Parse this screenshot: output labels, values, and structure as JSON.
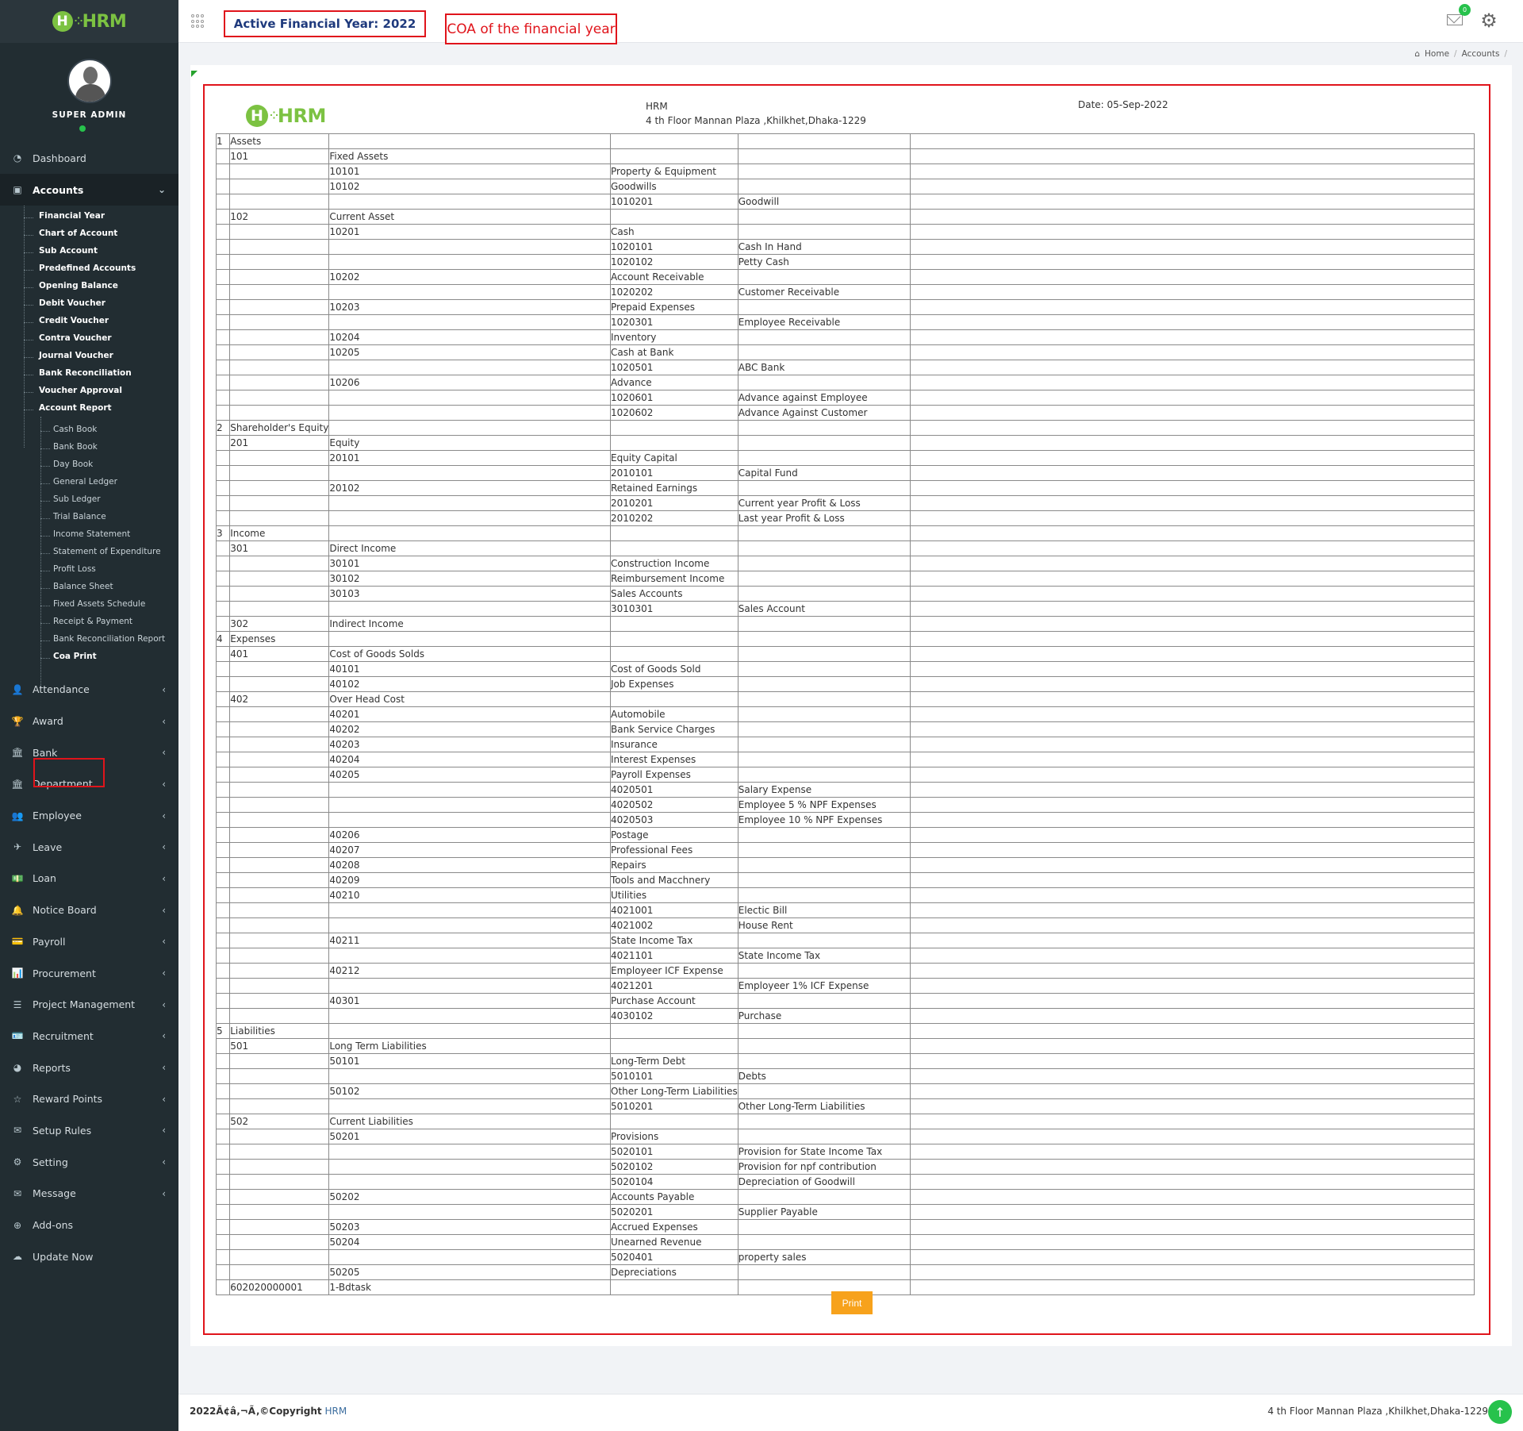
{
  "brand": {
    "logo_letter": "H",
    "logo_text": "HRM"
  },
  "user": {
    "name": "SUPER ADMIN"
  },
  "header": {
    "active_financial_year": "Active Financial Year: 2022",
    "page_title": "COA of the financial year",
    "mail_badge": "0"
  },
  "breadcrumb": {
    "home": "Home",
    "current": "Accounts"
  },
  "sidebar": {
    "dashboard": "Dashboard",
    "accounts": "Accounts",
    "accounts_sub": [
      "Financial Year",
      "Chart of Account",
      "Sub Account",
      "Predefined Accounts",
      "Opening Balance",
      "Debit Voucher",
      "Credit Voucher",
      "Contra Voucher",
      "Journal Voucher",
      "Bank Reconciliation",
      "Voucher Approval",
      "Account Report"
    ],
    "report_sub": [
      "Cash Book",
      "Bank Book",
      "Day Book",
      "General Ledger",
      "Sub Ledger",
      "Trial Balance",
      "Income Statement",
      "Statement of Expenditure",
      "Profit Loss",
      "Balance Sheet",
      "Fixed Assets Schedule",
      "Receipt & Payment",
      "Bank Reconciliation Report",
      "Coa Print"
    ],
    "modules": [
      {
        "label": "Attendance",
        "icon": "user-icon",
        "glyph": "👤"
      },
      {
        "label": "Award",
        "icon": "trophy-icon",
        "glyph": "🏆"
      },
      {
        "label": "Bank",
        "icon": "bank-icon",
        "glyph": "🏛"
      },
      {
        "label": "Department",
        "icon": "building-icon",
        "glyph": "🏛"
      },
      {
        "label": "Employee",
        "icon": "users-icon",
        "glyph": "👥"
      },
      {
        "label": "Leave",
        "icon": "plane-icon",
        "glyph": "✈"
      },
      {
        "label": "Loan",
        "icon": "money-icon",
        "glyph": "💵"
      },
      {
        "label": "Notice Board",
        "icon": "bell-icon",
        "glyph": "🔔"
      },
      {
        "label": "Payroll",
        "icon": "card-icon",
        "glyph": "💳"
      },
      {
        "label": "Procurement",
        "icon": "chart-icon",
        "glyph": "📊"
      },
      {
        "label": "Project Management",
        "icon": "server-icon",
        "glyph": "☰"
      },
      {
        "label": "Recruitment",
        "icon": "id-card-icon",
        "glyph": "🪪"
      },
      {
        "label": "Reports",
        "icon": "pie-chart-icon",
        "glyph": "◕"
      },
      {
        "label": "Reward Points",
        "icon": "star-icon",
        "glyph": "☆"
      },
      {
        "label": "Setup Rules",
        "icon": "envelope-icon",
        "glyph": "✉"
      },
      {
        "label": "Setting",
        "icon": "gear-icon",
        "glyph": "⚙"
      },
      {
        "label": "Message",
        "icon": "envelope-icon",
        "glyph": "✉"
      },
      {
        "label": "Add-ons",
        "icon": "plus-circle-icon",
        "glyph": "⊕"
      },
      {
        "label": "Update Now",
        "icon": "cloud-icon",
        "glyph": "☁"
      }
    ]
  },
  "document": {
    "company_name": "HRM",
    "company_address": "4 th Floor Mannan Plaza ,Khilkhet,Dhaka-1229",
    "date": "Date: 05-Sep-2022",
    "print_label": "Print"
  },
  "coa_rows": [
    [
      "1",
      "Assets",
      "",
      "",
      "",
      ""
    ],
    [
      "",
      "101",
      "Fixed Assets",
      "",
      "",
      ""
    ],
    [
      "",
      "",
      "10101",
      "Property & Equipment",
      "",
      ""
    ],
    [
      "",
      "",
      "10102",
      "Goodwills",
      "",
      ""
    ],
    [
      "",
      "",
      "",
      "1010201",
      "Goodwill",
      ""
    ],
    [
      "",
      "102",
      "Current Asset",
      "",
      "",
      ""
    ],
    [
      "",
      "",
      "10201",
      "Cash",
      "",
      ""
    ],
    [
      "",
      "",
      "",
      "1020101",
      "Cash In Hand",
      ""
    ],
    [
      "",
      "",
      "",
      "1020102",
      "Petty Cash",
      ""
    ],
    [
      "",
      "",
      "10202",
      "Account Receivable",
      "",
      ""
    ],
    [
      "",
      "",
      "",
      "1020202",
      "Customer Receivable",
      ""
    ],
    [
      "",
      "",
      "10203",
      "Prepaid Expenses",
      "",
      ""
    ],
    [
      "",
      "",
      "",
      "1020301",
      "Employee Receivable",
      ""
    ],
    [
      "",
      "",
      "10204",
      "Inventory",
      "",
      ""
    ],
    [
      "",
      "",
      "10205",
      "Cash at Bank",
      "",
      ""
    ],
    [
      "",
      "",
      "",
      "1020501",
      "ABC Bank",
      ""
    ],
    [
      "",
      "",
      "10206",
      "Advance",
      "",
      ""
    ],
    [
      "",
      "",
      "",
      "1020601",
      "Advance against Employee",
      ""
    ],
    [
      "",
      "",
      "",
      "1020602",
      "Advance Against Customer",
      ""
    ],
    [
      "2",
      "Shareholder's Equity",
      "",
      "",
      "",
      ""
    ],
    [
      "",
      "201",
      "Equity",
      "",
      "",
      ""
    ],
    [
      "",
      "",
      "20101",
      "Equity Capital",
      "",
      ""
    ],
    [
      "",
      "",
      "",
      "2010101",
      "Capital Fund",
      ""
    ],
    [
      "",
      "",
      "20102",
      "Retained Earnings",
      "",
      ""
    ],
    [
      "",
      "",
      "",
      "2010201",
      "Current year Profit & Loss",
      ""
    ],
    [
      "",
      "",
      "",
      "2010202",
      "Last year Profit & Loss",
      ""
    ],
    [
      "3",
      "Income",
      "",
      "",
      "",
      ""
    ],
    [
      "",
      "301",
      "Direct Income",
      "",
      "",
      ""
    ],
    [
      "",
      "",
      "30101",
      "Construction Income",
      "",
      ""
    ],
    [
      "",
      "",
      "30102",
      "Reimbursement Income",
      "",
      ""
    ],
    [
      "",
      "",
      "30103",
      "Sales Accounts",
      "",
      ""
    ],
    [
      "",
      "",
      "",
      "3010301",
      "Sales Account",
      ""
    ],
    [
      "",
      "302",
      "Indirect Income",
      "",
      "",
      ""
    ],
    [
      "4",
      "Expenses",
      "",
      "",
      "",
      ""
    ],
    [
      "",
      "401",
      "Cost of Goods Solds",
      "",
      "",
      ""
    ],
    [
      "",
      "",
      "40101",
      "Cost of Goods Sold",
      "",
      ""
    ],
    [
      "",
      "",
      "40102",
      "Job Expenses",
      "",
      ""
    ],
    [
      "",
      "402",
      "Over Head Cost",
      "",
      "",
      ""
    ],
    [
      "",
      "",
      "40201",
      "Automobile",
      "",
      ""
    ],
    [
      "",
      "",
      "40202",
      "Bank Service Charges",
      "",
      ""
    ],
    [
      "",
      "",
      "40203",
      "Insurance",
      "",
      ""
    ],
    [
      "",
      "",
      "40204",
      "Interest Expenses",
      "",
      ""
    ],
    [
      "",
      "",
      "40205",
      "Payroll Expenses",
      "",
      ""
    ],
    [
      "",
      "",
      "",
      "4020501",
      "Salary Expense",
      ""
    ],
    [
      "",
      "",
      "",
      "4020502",
      "Employee 5 % NPF Expenses",
      ""
    ],
    [
      "",
      "",
      "",
      "4020503",
      "Employee 10 % NPF Expenses",
      ""
    ],
    [
      "",
      "",
      "40206",
      "Postage",
      "",
      ""
    ],
    [
      "",
      "",
      "40207",
      "Professional Fees",
      "",
      ""
    ],
    [
      "",
      "",
      "40208",
      "Repairs",
      "",
      ""
    ],
    [
      "",
      "",
      "40209",
      "Tools and Macchnery",
      "",
      ""
    ],
    [
      "",
      "",
      "40210",
      "Utilities",
      "",
      ""
    ],
    [
      "",
      "",
      "",
      "4021001",
      "Electic Bill",
      ""
    ],
    [
      "",
      "",
      "",
      "4021002",
      "House Rent",
      ""
    ],
    [
      "",
      "",
      "40211",
      "State Income Tax",
      "",
      ""
    ],
    [
      "",
      "",
      "",
      "4021101",
      "State Income Tax",
      ""
    ],
    [
      "",
      "",
      "40212",
      "Employeer ICF Expense",
      "",
      ""
    ],
    [
      "",
      "",
      "",
      "4021201",
      "Employeer 1% ICF Expense",
      ""
    ],
    [
      "",
      "",
      "40301",
      "Purchase Account",
      "",
      ""
    ],
    [
      "",
      "",
      "",
      "4030102",
      "Purchase",
      ""
    ],
    [
      "5",
      "Liabilities",
      "",
      "",
      "",
      ""
    ],
    [
      "",
      "501",
      "Long Term Liabilities",
      "",
      "",
      ""
    ],
    [
      "",
      "",
      "50101",
      "Long-Term Debt",
      "",
      ""
    ],
    [
      "",
      "",
      "",
      "5010101",
      "Debts",
      ""
    ],
    [
      "",
      "",
      "50102",
      "Other Long-Term Liabilities",
      "",
      ""
    ],
    [
      "",
      "",
      "",
      "5010201",
      "Other Long-Term Liabilities",
      ""
    ],
    [
      "",
      "502",
      "Current Liabilities",
      "",
      "",
      ""
    ],
    [
      "",
      "",
      "50201",
      "Provisions",
      "",
      ""
    ],
    [
      "",
      "",
      "",
      "5020101",
      "Provision for State Income Tax",
      ""
    ],
    [
      "",
      "",
      "",
      "5020102",
      "Provision for npf contribution",
      ""
    ],
    [
      "",
      "",
      "",
      "5020104",
      "Depreciation of Goodwill",
      ""
    ],
    [
      "",
      "",
      "50202",
      "Accounts Payable",
      "",
      ""
    ],
    [
      "",
      "",
      "",
      "5020201",
      "Supplier Payable",
      ""
    ],
    [
      "",
      "",
      "50203",
      "Accrued Expenses",
      "",
      ""
    ],
    [
      "",
      "",
      "50204",
      "Unearned Revenue",
      "",
      ""
    ],
    [
      "",
      "",
      "",
      "5020401",
      "property sales",
      ""
    ],
    [
      "",
      "",
      "50205",
      "Depreciations",
      "",
      ""
    ],
    [
      "",
      "602020000001",
      "1-Bdtask",
      "",
      "",
      ""
    ]
  ],
  "footer": {
    "copyright_prefix": "2022Ã¢â‚¬Ã‚©Copyright",
    "copyright_brand": "HRM",
    "address": "4 th Floor Mannan Plaza ,Khilkhet,Dhaka-1229"
  },
  "colors": {
    "sidebar_bg": "#222d32",
    "brand_green": "#7cc242",
    "highlight_red": "#e0141b",
    "print_orange": "#f7a21c"
  }
}
